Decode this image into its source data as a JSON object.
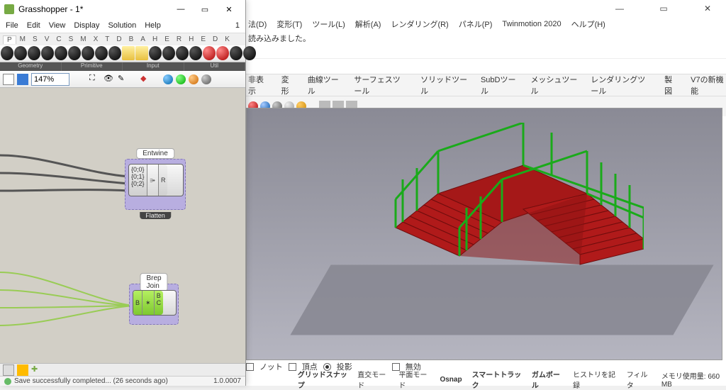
{
  "rhino": {
    "menu": [
      "法(D)",
      "変形(T)",
      "ツール(L)",
      "解析(A)",
      "レンダリング(R)",
      "パネル(P)",
      "Twinmotion 2020",
      "ヘルプ(H)"
    ],
    "info": "読み込みました。",
    "tabs": [
      "非表示",
      "変形",
      "曲線ツール",
      "サーフェスツール",
      "ソリッドツール",
      "SubDツール",
      "メッシュツール",
      "レンダリングツール",
      "製図",
      "V7の新機能"
    ],
    "view_options": {
      "o1": "ノット",
      "o2": "頂点",
      "o3": "投影",
      "o4": "無効"
    },
    "status": {
      "s1": "グリッドスナップ",
      "s2": "直交モード",
      "s3": "平面モード",
      "s4": "Osnap",
      "s5": "スマートトラック",
      "s6": "ガムボール",
      "s7": "ヒストリを記録",
      "s8": "フィルタ",
      "s9": "メモリ使用量: 660 MB"
    },
    "win": {
      "min": "—",
      "max": "▭",
      "close": "✕"
    }
  },
  "gh": {
    "title": "Grasshopper - 1*",
    "menu": [
      "File",
      "Edit",
      "View",
      "Display",
      "Solution",
      "Help"
    ],
    "menu_right": "1",
    "ribbon": [
      "P",
      "M",
      "S",
      "V",
      "C",
      "S",
      "M",
      "X",
      "T",
      "D",
      "B",
      "A",
      "H",
      "E",
      "R",
      "H",
      "E",
      "D",
      "K"
    ],
    "groups": [
      "Geometry",
      "Primitive",
      "Input",
      "Util"
    ],
    "zoom": "147%",
    "entwine": {
      "label": "Entwine",
      "i0": "{0;0}",
      "i1": "{0;1}",
      "i2": "{0;2}",
      "out": "R",
      "flatten": "Flatten"
    },
    "brepjoin": {
      "label": "Brep Join",
      "in": "B",
      "o1": "B",
      "o2": "C"
    },
    "status": "Save successfully completed... (26 seconds ago)",
    "version": "1.0.0007",
    "win": {
      "min": "—",
      "max": "▭",
      "close": "✕"
    }
  }
}
